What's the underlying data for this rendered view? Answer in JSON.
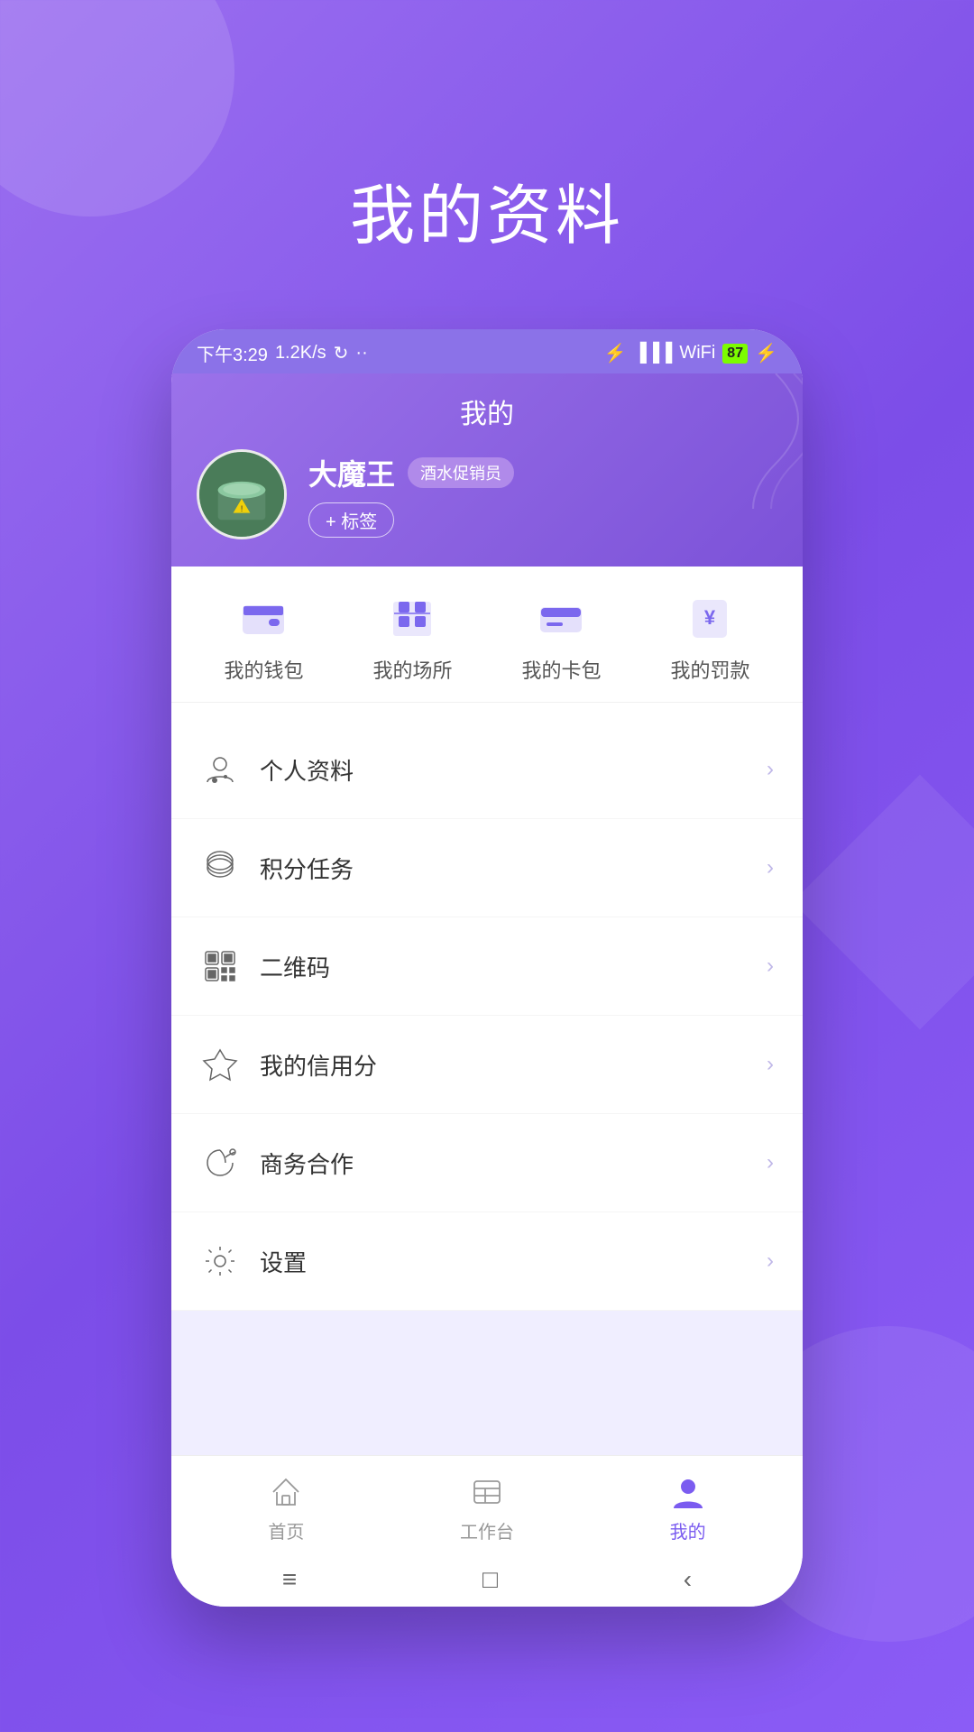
{
  "page": {
    "title": "我的资料",
    "background_color": "#8B5CF6"
  },
  "status_bar": {
    "time": "下午3:29",
    "network_speed": "1.2K/s",
    "battery": "87",
    "icons": [
      "bluetooth",
      "signal",
      "wifi",
      "battery"
    ]
  },
  "header": {
    "nav_title": "我的",
    "profile": {
      "name": "大魔王",
      "role_badge": "酒水促销员",
      "tag_button": "+ 标签"
    }
  },
  "quick_actions": [
    {
      "id": "wallet",
      "label": "我的钱包"
    },
    {
      "id": "venue",
      "label": "我的场所"
    },
    {
      "id": "card",
      "label": "我的卡包"
    },
    {
      "id": "fine",
      "label": "我的罚款"
    }
  ],
  "menu_items": [
    {
      "id": "profile",
      "label": "个人资料"
    },
    {
      "id": "points",
      "label": "积分任务"
    },
    {
      "id": "qrcode",
      "label": "二维码"
    },
    {
      "id": "credit",
      "label": "我的信用分"
    },
    {
      "id": "business",
      "label": "商务合作"
    },
    {
      "id": "settings",
      "label": "设置"
    }
  ],
  "bottom_nav": [
    {
      "id": "home",
      "label": "首页",
      "active": false
    },
    {
      "id": "workbench",
      "label": "工作台",
      "active": false
    },
    {
      "id": "mine",
      "label": "我的",
      "active": true
    }
  ],
  "system_nav": {
    "menu_icon": "≡",
    "home_icon": "□",
    "back_icon": "‹"
  }
}
